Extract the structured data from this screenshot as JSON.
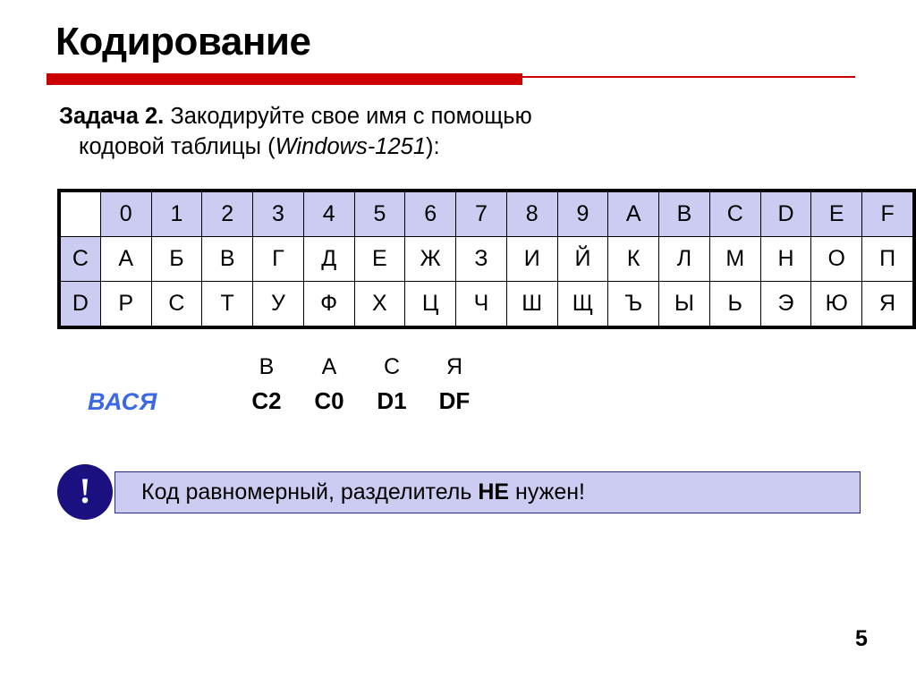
{
  "slide": {
    "title": "Кодирование",
    "page_number": "5",
    "accent_color": "#CC0000",
    "header_cell_color": "#CCCCF2",
    "example_word_color": "#3A68E6",
    "badge_color": "#1B1080"
  },
  "task": {
    "label": "Задача 2.",
    "line1_rest": " Закодируйте свое имя с помощью",
    "line2_before": "кодовой таблицы (",
    "line2_italic": "Windows-1251",
    "line2_after": "):"
  },
  "code_table": {
    "corner": "",
    "columns": [
      "0",
      "1",
      "2",
      "3",
      "4",
      "5",
      "6",
      "7",
      "8",
      "9",
      "A",
      "B",
      "C",
      "D",
      "E",
      "F"
    ],
    "rows": [
      {
        "label": "C",
        "cells": [
          "А",
          "Б",
          "В",
          "Г",
          "Д",
          "Е",
          "Ж",
          "З",
          "И",
          "Й",
          "К",
          "Л",
          "М",
          "Н",
          "О",
          "П"
        ]
      },
      {
        "label": "D",
        "cells": [
          "Р",
          "С",
          "Т",
          "У",
          "Ф",
          "Х",
          "Ц",
          "Ч",
          "Ш",
          "Щ",
          "Ъ",
          "Ы",
          "Ь",
          "Э",
          "Ю",
          "Я"
        ]
      }
    ]
  },
  "example": {
    "word": "ВАСЯ",
    "letters": [
      "В",
      "А",
      "С",
      "Я"
    ],
    "codes": [
      "C2",
      "C0",
      "D1",
      "DF"
    ]
  },
  "note": {
    "badge_glyph": "!",
    "text_before": "Код равномерный, разделитель ",
    "text_bold": "НЕ",
    "text_after": " нужен!"
  }
}
